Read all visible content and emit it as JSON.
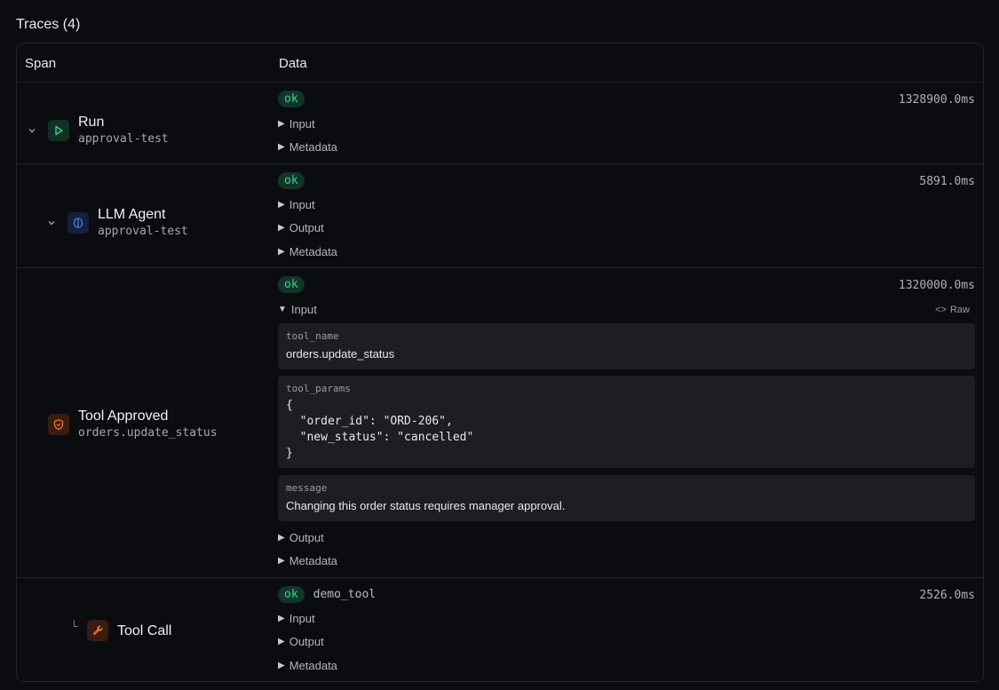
{
  "header": {
    "title": "Traces (4)"
  },
  "columns": {
    "span": "Span",
    "data": "Data"
  },
  "rows": [
    {
      "name": "Run",
      "sub": "approval-test",
      "icon": "play-icon",
      "status": "ok",
      "duration": "1328900.0ms",
      "toggles": [
        "Input",
        "Metadata"
      ]
    },
    {
      "name": "LLM Agent",
      "sub": "approval-test",
      "icon": "brain-icon",
      "status": "ok",
      "duration": "5891.0ms",
      "toggles": [
        "Input",
        "Output",
        "Metadata"
      ]
    },
    {
      "name": "Tool Approved",
      "sub": "orders.update_status",
      "icon": "shield-icon",
      "status": "ok",
      "duration": "1320000.0ms",
      "input_label": "Input",
      "raw_label": "Raw",
      "fields": [
        {
          "key": "tool_name",
          "value": "orders.update_status"
        },
        {
          "key": "tool_params",
          "lines": [
            "{",
            "  \"order_id\": \"ORD-206\",",
            "  \"new_status\": \"cancelled\"",
            "}"
          ]
        },
        {
          "key": "message",
          "value": "Changing this order status requires manager approval."
        }
      ],
      "toggles": [
        "Output",
        "Metadata"
      ]
    },
    {
      "name": "Tool Call",
      "icon": "wrench-icon",
      "status": "ok",
      "tool": "demo_tool",
      "duration": "2526.0ms",
      "toggles": [
        "Input",
        "Output",
        "Metadata"
      ]
    }
  ]
}
